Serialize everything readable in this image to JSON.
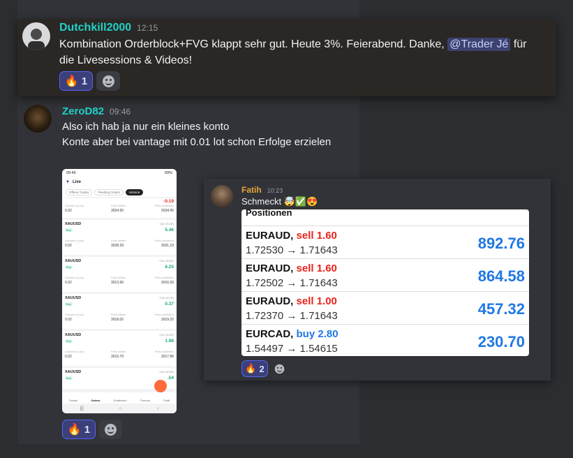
{
  "msg1": {
    "author": "Dutchkill2000",
    "time": "12:15",
    "text_before": "Kombination Orderblock+FVG klappt sehr gut. Heute 3%. Feierabend. Danke, ",
    "mention": "@Trader Jé",
    "text_after": " für die Livesessions & Videos!",
    "reaction_emoji": "🔥",
    "reaction_count": "1"
  },
  "msg2": {
    "author": "ZeroD82",
    "time": "09:46",
    "lines": [
      "Also ich hab ja nur ein kleines konto",
      "Konte aber bei vantage mit 0.01 lot schon Erfolge erzielen"
    ],
    "reaction_emoji": "🔥",
    "reaction_count": "1",
    "phone": {
      "status_time": "09:46",
      "battery": "69%",
      "header_title": "Live",
      "tabs": [
        "Offene Trades",
        "Pending Orders",
        "Historie"
      ],
      "first_row": {
        "volume": "0.02",
        "open": "3034.55",
        "close": "3034.45",
        "pnl": "-0.19"
      },
      "rows": [
        {
          "symbol": "XAUUSD",
          "pnl": "5.46",
          "volume": "0.02",
          "open": "3028.29",
          "close": "3031.23"
        },
        {
          "symbol": "XAUUSD",
          "pnl": "6.25",
          "volume": "0.02",
          "open": "3013.56",
          "close": "3016.93"
        },
        {
          "symbol": "XAUUSD",
          "pnl": "0.37",
          "volume": "0.02",
          "open": "3018.02",
          "close": "3019.22"
        },
        {
          "symbol": "XAUUSD",
          "pnl": "1.98",
          "volume": "0.02",
          "open": "3016.79",
          "close": "3017.86"
        },
        {
          "symbol": "XAUUSD",
          "pnl": ".54",
          "volume": "",
          "open": "",
          "close": ""
        }
      ],
      "labels": {
        "volume": "Volumen (Lots)",
        "open": "Preis öffnen",
        "close": "Preis schließen",
        "gv": "G&V (EUR)",
        "buy": "Buy"
      },
      "nav": [
        "Trades",
        "Orders",
        "Entdecken",
        "Promos",
        "Profil"
      ]
    }
  },
  "msg3": {
    "author": "Fatih",
    "time": "10:23",
    "text": "Schmeckt 🤯✅😍",
    "reaction_emoji": "🔥",
    "reaction_count": "2",
    "positions_title": "Positionen",
    "positions": [
      {
        "symbol": "EURAUD,",
        "side": "sell 1.60",
        "from_to": "1.72530 → 1.71643",
        "pnl": "892.76"
      },
      {
        "symbol": "EURAUD,",
        "side": "sell 1.60",
        "from_to": "1.72502 → 1.71643",
        "pnl": "864.58"
      },
      {
        "symbol": "EURAUD,",
        "side": "sell 1.00",
        "from_to": "1.72370 → 1.71643",
        "pnl": "457.32"
      },
      {
        "symbol": "EURCAD,",
        "side": "buy 2.80",
        "from_to": "1.54497 → 1.54615",
        "pnl": "230.70"
      }
    ]
  },
  "colors": {
    "username_teal": "#1fd1c8",
    "username_orange": "#e8a23a",
    "sell_red": "#e8241c",
    "buy_blue": "#1f78e4",
    "mention_bg": "#3c4270"
  }
}
